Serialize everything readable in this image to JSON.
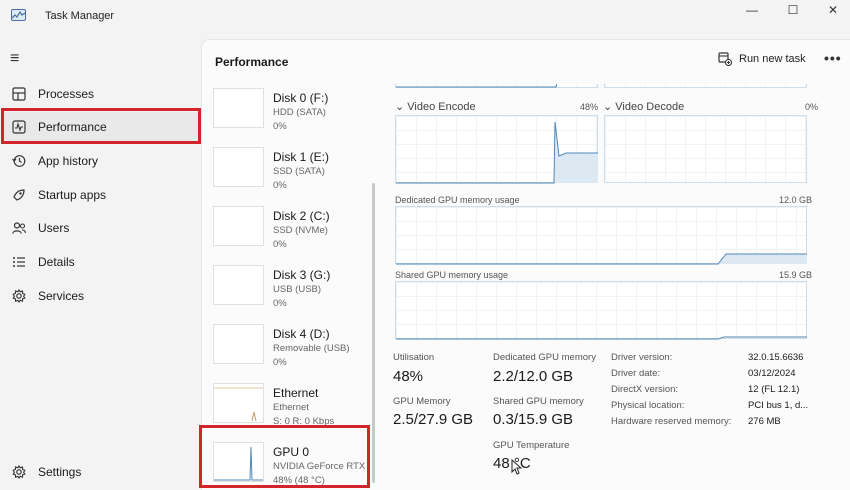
{
  "window": {
    "title": "Task Manager",
    "minimize": "—",
    "maximize": "☐",
    "close": "✕"
  },
  "nav": {
    "items": [
      {
        "label": "Processes",
        "icon": "processes-icon"
      },
      {
        "label": "Performance",
        "icon": "performance-icon",
        "active": true
      },
      {
        "label": "App history",
        "icon": "app-history-icon"
      },
      {
        "label": "Startup apps",
        "icon": "startup-apps-icon"
      },
      {
        "label": "Users",
        "icon": "users-icon"
      },
      {
        "label": "Details",
        "icon": "details-icon"
      },
      {
        "label": "Services",
        "icon": "services-icon"
      }
    ],
    "settings": "Settings"
  },
  "header": {
    "title": "Performance",
    "run_new_task": "Run new task",
    "more": "•••"
  },
  "devices": [
    {
      "name": "Disk 0 (F:)",
      "type": "HDD (SATA)",
      "usage": "0%"
    },
    {
      "name": "Disk 1 (E:)",
      "type": "SSD (SATA)",
      "usage": "0%"
    },
    {
      "name": "Disk 2 (C:)",
      "type": "SSD (NVMe)",
      "usage": "0%"
    },
    {
      "name": "Disk 3 (G:)",
      "type": "USB (USB)",
      "usage": "0%"
    },
    {
      "name": "Disk 4 (D:)",
      "type": "Removable (USB)",
      "usage": "0%"
    },
    {
      "name": "Ethernet",
      "type": "Ethernet",
      "usage": "S: 0 R: 0 Kbps"
    },
    {
      "name": "GPU 0",
      "type": "NVIDIA GeForce RTX",
      "usage": "48% (48 °C)",
      "selected": true
    }
  ],
  "detail": {
    "video_encode": {
      "label": "Video Encode",
      "value": "48%"
    },
    "video_decode": {
      "label": "Video Decode",
      "value": "0%"
    },
    "dedicated_mem": {
      "label": "Dedicated GPU memory usage",
      "max": "12.0 GB"
    },
    "shared_mem": {
      "label": "Shared GPU memory usage",
      "max": "15.9 GB"
    },
    "stats": {
      "utilisation": {
        "label": "Utilisation",
        "value": "48%"
      },
      "dedicated": {
        "label": "Dedicated GPU memory",
        "value": "2.2/12.0 GB"
      },
      "gpu_memory": {
        "label": "GPU Memory",
        "value": "2.5/27.9 GB"
      },
      "shared": {
        "label": "Shared GPU memory",
        "value": "0.3/15.9 GB"
      },
      "temperature": {
        "label": "GPU Temperature",
        "value": "48 °C"
      }
    },
    "info": [
      {
        "key": "Driver version:",
        "value": "32.0.15.6636"
      },
      {
        "key": "Driver date:",
        "value": "03/12/2024"
      },
      {
        "key": "DirectX version:",
        "value": "12 (FL 12.1)"
      },
      {
        "key": "Physical location:",
        "value": "PCI bus 1, d..."
      },
      {
        "key": "Hardware reserved memory:",
        "value": "276 MB"
      }
    ]
  },
  "colors": {
    "accent_box": "#d3232b",
    "graph_line": "#4f87b5",
    "graph_fill": "#c9dcec"
  }
}
